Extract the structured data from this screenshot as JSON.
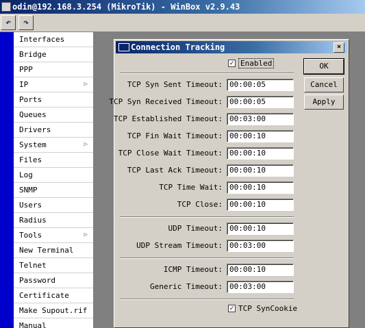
{
  "window": {
    "title": "odin@192.168.3.254 (MikroTik) - WinBox v2.9.43"
  },
  "toolbar": {
    "undo_icon": "undo-icon",
    "redo_icon": "redo-icon"
  },
  "sidebar": {
    "items": [
      {
        "label": "Interfaces"
      },
      {
        "label": "Bridge"
      },
      {
        "label": "PPP"
      },
      {
        "label": "IP",
        "submenu": "▷"
      },
      {
        "label": "Ports"
      },
      {
        "label": "Queues"
      },
      {
        "label": "Drivers"
      },
      {
        "label": "System",
        "submenu": "▷"
      },
      {
        "label": "Files"
      },
      {
        "label": "Log"
      },
      {
        "label": "SNMP"
      },
      {
        "label": "Users"
      },
      {
        "label": "Radius"
      },
      {
        "label": "Tools",
        "submenu": "▷"
      },
      {
        "label": "New Terminal"
      },
      {
        "label": "Telnet"
      },
      {
        "label": "Password"
      },
      {
        "label": "Certificate"
      },
      {
        "label": "Make Supout.rif"
      },
      {
        "label": "Manual"
      }
    ]
  },
  "dialog": {
    "title": "Connection Tracking",
    "close_label": "×",
    "enabled": {
      "label": "Enabled",
      "checked": true,
      "mark": "✓"
    },
    "fields": [
      {
        "label": "TCP Syn Sent Timeout:",
        "value": "00:00:05"
      },
      {
        "label": "TCP Syn Received Timeout:",
        "value": "00:00:05"
      },
      {
        "label": "TCP Established Timeout:",
        "value": "00:03:00"
      },
      {
        "label": "TCP Fin Wait Timeout:",
        "value": "00:00:10"
      },
      {
        "label": "TCP Close Wait Timeout:",
        "value": "00:00:10"
      },
      {
        "label": "TCP Last Ack Timeout:",
        "value": "00:00:10"
      },
      {
        "label": "TCP Time Wait:",
        "value": "00:00:10"
      },
      {
        "label": "TCP Close:",
        "value": "00:00:10"
      },
      {
        "label": "UDP Timeout:",
        "value": "00:00:10"
      },
      {
        "label": "UDP Stream Timeout:",
        "value": "00:03:00"
      },
      {
        "label": "ICMP Timeout:",
        "value": "00:00:10"
      },
      {
        "label": "Generic Timeout:",
        "value": "00:03:00"
      }
    ],
    "syncookie": {
      "label": "TCP SynCookie",
      "checked": true,
      "mark": "✓"
    },
    "buttons": {
      "ok": "OK",
      "cancel": "Cancel",
      "apply": "Apply"
    }
  }
}
